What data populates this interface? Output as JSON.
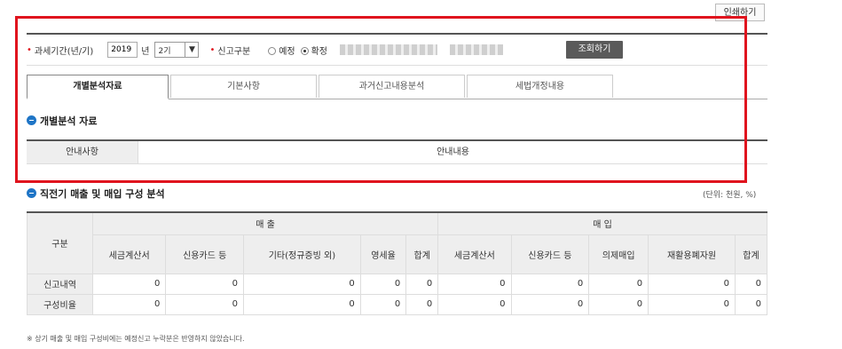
{
  "print_label": "인쇄하기",
  "filter": {
    "period_label": "과세기간(년/기)",
    "year_value": "2019",
    "year_unit": "년",
    "half_value": "2기",
    "report_type_label": "신고구분",
    "radio_options": [
      "예정",
      "확정"
    ],
    "query_label": "조회하기"
  },
  "tabs": [
    "개별분석자료",
    "기본사항",
    "과거신고내용분석",
    "세법개정내용"
  ],
  "section1": {
    "title": "개별분석 자료",
    "col_guide": "안내사항",
    "col_content": "안내내용"
  },
  "section2": {
    "title": "직전기 매출 및 매입 구성 분석",
    "unit": "(단위: 천원, %)",
    "group_label": "구분",
    "sales_label": "매 출",
    "purchase_label": "매 입",
    "sales_cols": [
      "세금계산서",
      "신용카드 등",
      "기타(정규증빙 외)",
      "영세율",
      "합계"
    ],
    "purchase_cols": [
      "세금계산서",
      "신용카드 등",
      "의제매입",
      "재활용폐자원",
      "합계"
    ],
    "rows": [
      {
        "label": "신고내역",
        "values": [
          "0",
          "0",
          "0",
          "0",
          "0",
          "0",
          "0",
          "0",
          "0",
          "0"
        ]
      },
      {
        "label": "구성비율",
        "values": [
          "0",
          "0",
          "0",
          "0",
          "0",
          "0",
          "0",
          "0",
          "0",
          "0"
        ]
      }
    ]
  },
  "footnote": "※ 상기 매출 및 매입 구성비에는 예정신고 누락분은 반영하지 않았습니다.",
  "colors": {
    "highlight": "#e0141e",
    "accent": "#1f75c6",
    "button": "#5a5a5a"
  }
}
